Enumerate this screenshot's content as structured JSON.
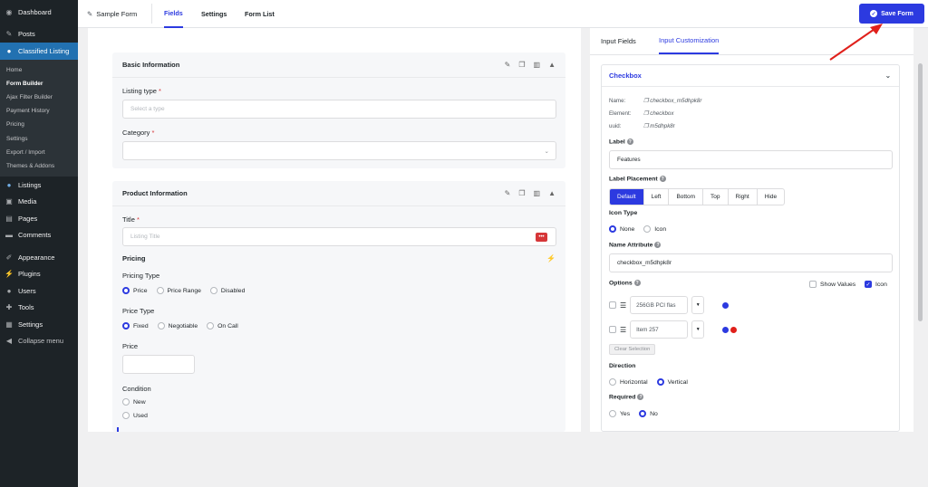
{
  "admin_menu": {
    "items_top": [
      {
        "label": "Dashboard",
        "icon": "dashboard-icon",
        "glyph": "◉"
      },
      {
        "label": "Posts",
        "icon": "pin-icon",
        "glyph": "✎"
      }
    ],
    "active": {
      "label": "Classified Listing",
      "icon": "map-marker-icon",
      "glyph": "●"
    },
    "submenu": [
      "Home",
      "Form Builder",
      "Ajax Filter Builder",
      "Payment History",
      "Pricing",
      "Settings",
      "Export / Import",
      "Themes & Addons"
    ],
    "items_bottom": [
      {
        "label": "Listings",
        "icon": "map-marker-icon",
        "glyph": "●"
      },
      {
        "label": "Media",
        "icon": "media-icon",
        "glyph": "▣"
      },
      {
        "label": "Pages",
        "icon": "pages-icon",
        "glyph": "▤"
      },
      {
        "label": "Comments",
        "icon": "comment-icon",
        "glyph": "▬"
      },
      {
        "label": "Appearance",
        "icon": "brush-icon",
        "glyph": "✐"
      },
      {
        "label": "Plugins",
        "icon": "plug-icon",
        "glyph": "⚡"
      },
      {
        "label": "Users",
        "icon": "user-icon",
        "glyph": "●"
      },
      {
        "label": "Tools",
        "icon": "wrench-icon",
        "glyph": "✚"
      },
      {
        "label": "Settings",
        "icon": "settings-icon",
        "glyph": "▦"
      },
      {
        "label": "Collapse menu",
        "icon": "collapse-icon",
        "glyph": "◀"
      }
    ]
  },
  "topbar": {
    "form_name": "Sample Form",
    "tabs": [
      "Fields",
      "Settings",
      "Form List"
    ],
    "save_label": "Save Form"
  },
  "canvas": {
    "basic": {
      "title": "Basic Information",
      "listing_type_label": "Listing type",
      "listing_type_placeholder": "Select a type",
      "category_label": "Category"
    },
    "product": {
      "title": "Product Information",
      "title_label": "Title",
      "title_placeholder": "Listing Title",
      "pricing_label": "Pricing",
      "pricing_type_label": "Pricing Type",
      "pricing_type_options": [
        "Price",
        "Price Range",
        "Disabled"
      ],
      "price_type_label": "Price Type",
      "price_type_options": [
        "Fixed",
        "Negotiable",
        "On Call"
      ],
      "price_label": "Price",
      "condition_label": "Condition",
      "condition_options": [
        "New",
        "Used"
      ]
    }
  },
  "panel": {
    "tabs": [
      "Input Fields",
      "Input Customization"
    ],
    "card_title": "Checkbox",
    "meta": [
      {
        "k": "Name:",
        "v": "checkbox_m5dhpk8r"
      },
      {
        "k": "Element:",
        "v": "checkbox"
      },
      {
        "k": "uuid:",
        "v": "m5dhpk8r"
      }
    ],
    "label_label": "Label",
    "label_value": "Features",
    "placement_label": "Label Placement",
    "placement_options": [
      "Default",
      "Left",
      "Bottom",
      "Top",
      "Right",
      "Hide"
    ],
    "icon_type_label": "Icon Type",
    "icon_type_options": [
      "None",
      "Icon"
    ],
    "name_attr_label": "Name Attribute",
    "name_attr_value": "checkbox_m5dhpk8r",
    "options_label": "Options",
    "show_values_label": "Show Values",
    "icon_label": "Icon",
    "option_items": [
      "256GB PCI flas",
      "Item 257"
    ],
    "clear_label": "Clear Selection",
    "direction_label": "Direction",
    "direction_options": [
      "Horizontal",
      "Vertical"
    ],
    "required_label": "Required",
    "required_options": [
      "Yes",
      "No"
    ]
  },
  "colors": {
    "accent": "#2c3ae0",
    "wp_sidebar": "#1d2327",
    "wp_active": "#2271b1",
    "arrow": "#e0201b"
  }
}
